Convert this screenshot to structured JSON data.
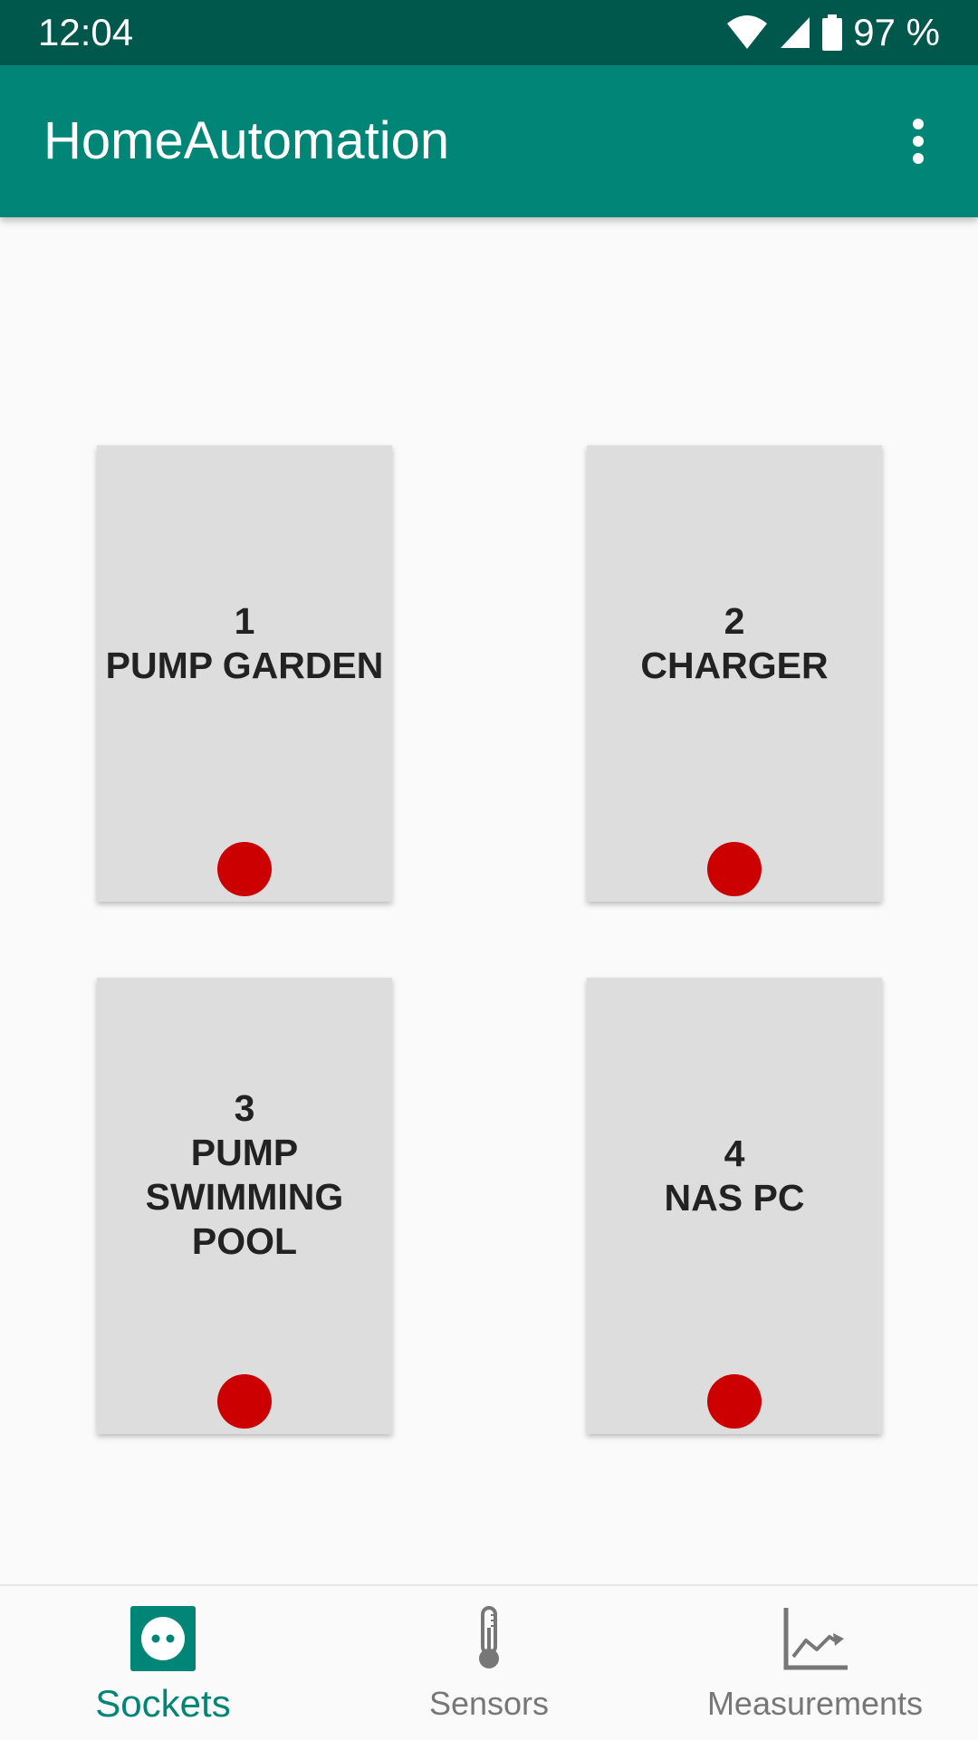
{
  "status_bar": {
    "time": "12:04",
    "battery_text": "97 %",
    "icons": [
      "wifi-icon",
      "cell-signal-icon",
      "battery-icon"
    ]
  },
  "app_bar": {
    "title": "HomeAutomation",
    "menu_icon": "more-vert-icon"
  },
  "sockets": [
    {
      "number": "1",
      "lines": [
        "PUMP GARDEN"
      ],
      "status": "off"
    },
    {
      "number": "2",
      "lines": [
        "CHARGER"
      ],
      "status": "off"
    },
    {
      "number": "3",
      "lines": [
        "PUMP",
        "SWIMMING",
        "POOL"
      ],
      "status": "off"
    },
    {
      "number": "4",
      "lines": [
        "NAS PC"
      ],
      "status": "off"
    }
  ],
  "bottom_nav": {
    "items": [
      {
        "label": "Sockets",
        "icon": "socket-icon",
        "active": true
      },
      {
        "label": "Sensors",
        "icon": "thermometer-icon",
        "active": false
      },
      {
        "label": "Measurements",
        "icon": "chart-icon",
        "active": false
      }
    ]
  },
  "colors": {
    "status_bar": "#00574b",
    "primary": "#008577",
    "card": "#dddddd",
    "status_off": "#cc0000",
    "inactive_nav": "#777777"
  }
}
